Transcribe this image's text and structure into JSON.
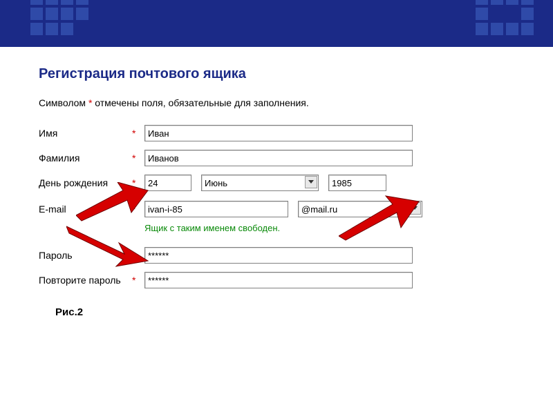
{
  "title": "Регистрация почтового ящика",
  "subtitle_pre": "Символом ",
  "subtitle_post": " отмечены поля, обязательные для заполнения.",
  "required_mark": "*",
  "labels": {
    "firstname": "Имя",
    "lastname": "Фамилия",
    "birthday": "День рождения",
    "email": "E-mail",
    "password": "Пароль",
    "password2": "Повторите пароль"
  },
  "values": {
    "firstname": "Иван",
    "lastname": "Иванов",
    "day": "24",
    "month": "Июнь",
    "year": "1985",
    "email_user": "ivan-i-85",
    "email_domain": "@mail.ru",
    "password": "******",
    "password2": "******"
  },
  "status": "Ящик с таким именем свободен.",
  "caption": "Рис.2",
  "colors": {
    "banner": "#1b2a87",
    "accent_green": "#0a8a0a",
    "required_red": "#d10000"
  }
}
